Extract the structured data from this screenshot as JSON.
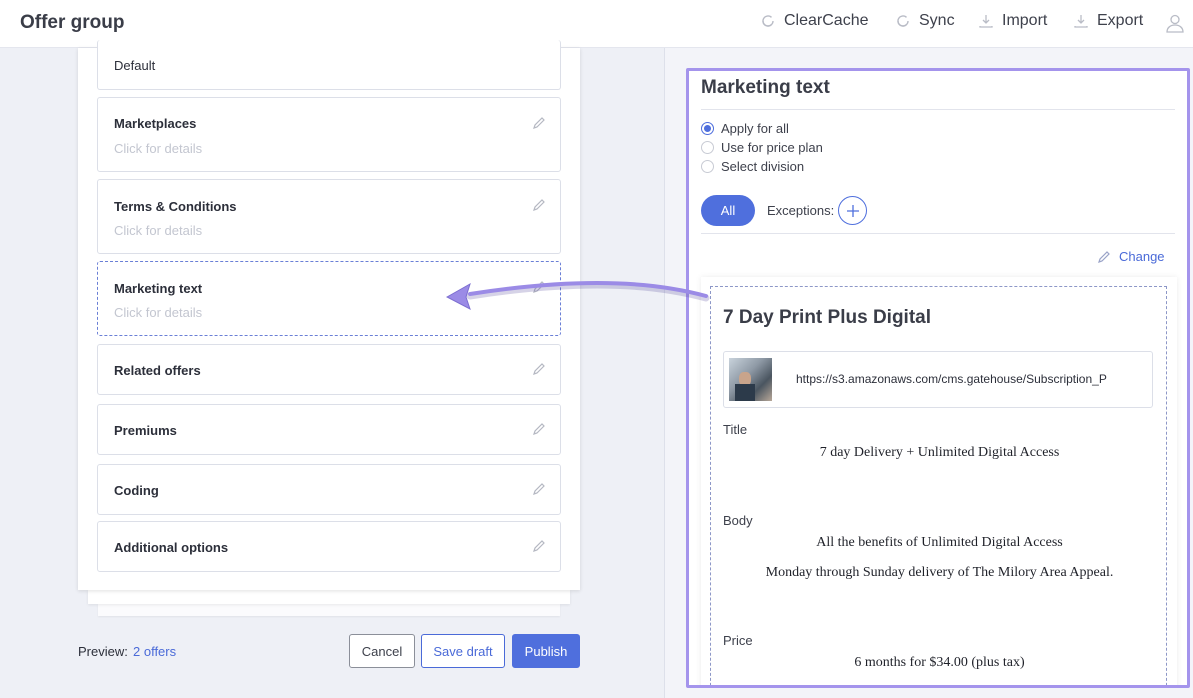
{
  "header": {
    "title": "Offer group",
    "actions": {
      "clear_cache": "ClearCache",
      "sync": "Sync",
      "import": "Import",
      "export": "Export"
    }
  },
  "sections": {
    "default_label": "Default",
    "marketplaces": {
      "title": "Marketplaces",
      "subtitle": "Click for details"
    },
    "terms": {
      "title": "Terms & Conditions",
      "subtitle": "Click for details"
    },
    "marketing_text": {
      "title": "Marketing text",
      "subtitle": "Click for details"
    },
    "related_offers": {
      "title": "Related offers"
    },
    "premiums": {
      "title": "Premiums"
    },
    "coding": {
      "title": "Coding"
    },
    "additional_options": {
      "title": "Additional options"
    }
  },
  "footer": {
    "preview_label": "Preview:",
    "preview_link": "2 offers",
    "cancel": "Cancel",
    "save_draft": "Save draft",
    "publish": "Publish"
  },
  "marketing_panel": {
    "title": "Marketing text",
    "options": [
      {
        "label": "Apply for all",
        "selected": true
      },
      {
        "label": "Use for price plan",
        "selected": false
      },
      {
        "label": "Select division",
        "selected": false
      }
    ],
    "all_pill": "All",
    "exceptions_label": "Exceptions:",
    "change_link": "Change",
    "preview": {
      "offer_name": "7 Day Print Plus Digital",
      "image_url": "https://s3.amazonaws.com/cms.gatehouse/Subscription_P",
      "title_label": "Title",
      "title_value": "7 day Delivery + Unlimited Digital Access",
      "body_label": "Body",
      "body_line1": "All the benefits of Unlimited Digital Access",
      "body_line2": "Monday through Sunday delivery of The Milory Area Appeal.",
      "price_label": "Price",
      "price_value": "6 months for $34.00 (plus tax)"
    }
  },
  "colors": {
    "accent": "#4f6fdd",
    "highlight_border": "#a494ec",
    "arrow": "#9b8be6"
  }
}
